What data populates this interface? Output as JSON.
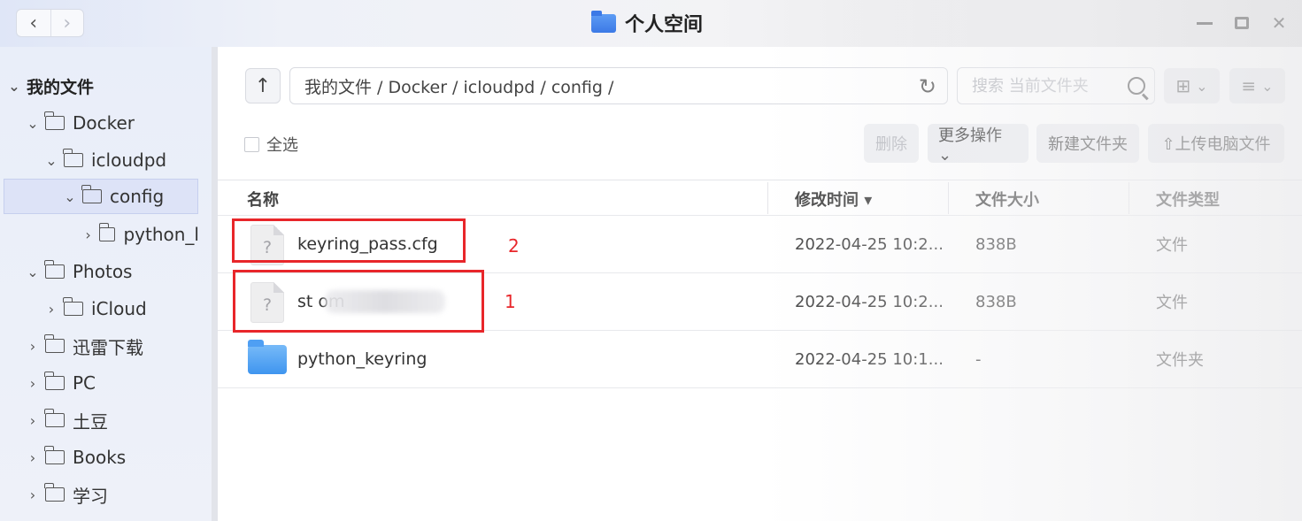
{
  "window": {
    "title": "个人空间",
    "nav_back": "‹",
    "nav_forward": "›",
    "close": "✕"
  },
  "sidebar": {
    "root": "我的文件",
    "items": [
      {
        "label": "Docker"
      },
      {
        "label": "icloudpd"
      },
      {
        "label": "config"
      },
      {
        "label": "python_l"
      },
      {
        "label": "Photos"
      },
      {
        "label": "iCloud"
      },
      {
        "label": "迅雷下载"
      },
      {
        "label": "PC"
      },
      {
        "label": "土豆"
      },
      {
        "label": "Books"
      },
      {
        "label": "学习"
      }
    ]
  },
  "toolbar": {
    "up": "↑",
    "path": "我的文件 / Docker / icloudpd / config /",
    "refresh": "↻",
    "search_placeholder": "搜索 当前文件夹",
    "view_toggle": "⊞",
    "sort_menu": "≡",
    "dropdown_chevron": "⌄"
  },
  "actions": {
    "select_all": "全选",
    "delete": "删除",
    "more": "更多操作 ⌄",
    "new_folder": "新建文件夹",
    "upload": "⇧上传电脑文件"
  },
  "table": {
    "headers": {
      "name": "名称",
      "modified": "修改时间 ▾",
      "size": "文件大小",
      "type": "文件类型"
    },
    "rows": [
      {
        "name": "keyring_pass.cfg",
        "modified": "2022-04-25 10:2...",
        "size": "838B",
        "type": "文件",
        "icon": "?"
      },
      {
        "name": "st                                  om",
        "modified": "2022-04-25 10:2...",
        "size": "838B",
        "type": "文件",
        "icon": "?"
      },
      {
        "name": "python_keyring",
        "modified": "2022-04-25 10:1...",
        "size": "-",
        "type": "文件夹"
      }
    ]
  },
  "annotations": {
    "label_1": "1",
    "label_2": "2",
    "color": "#e8262a"
  }
}
